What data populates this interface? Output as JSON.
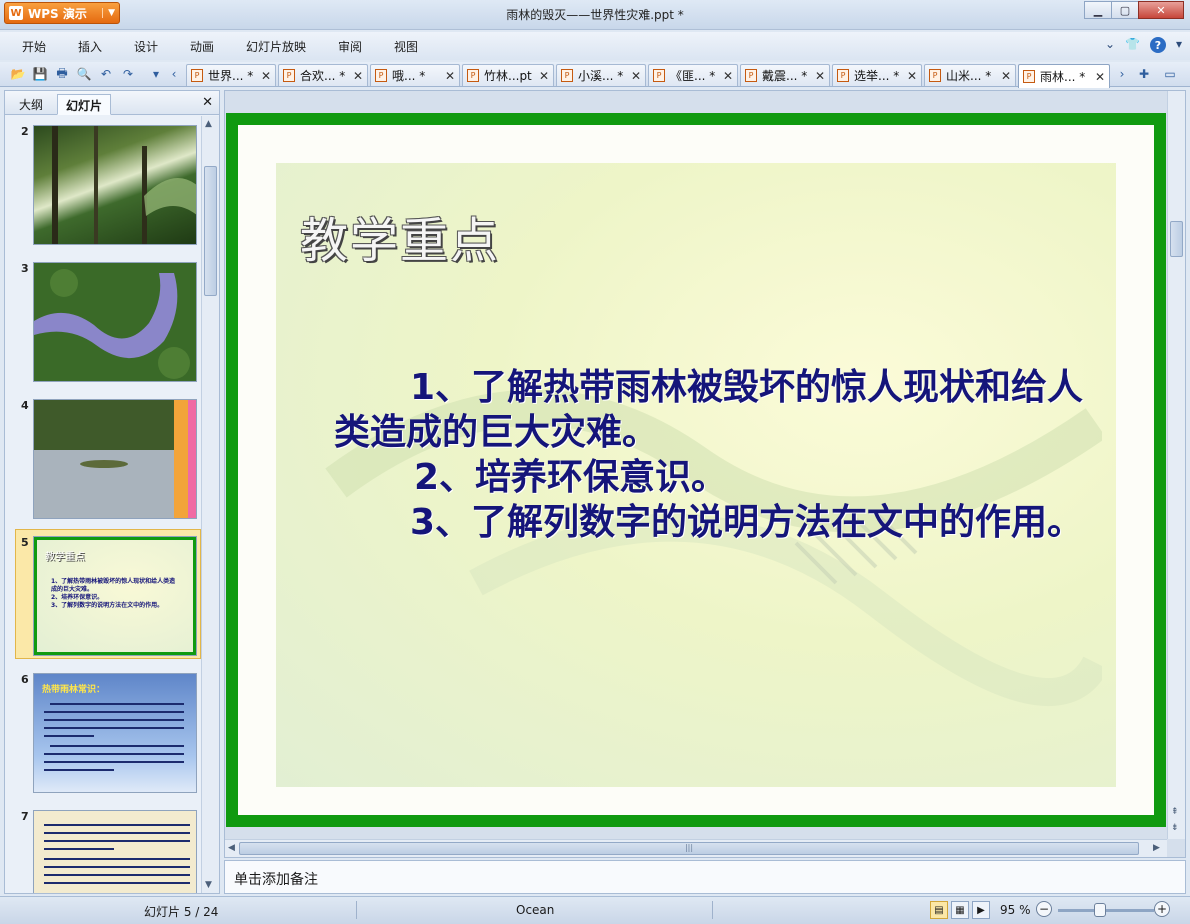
{
  "app": {
    "name": "WPS 演示",
    "window_title": "雨林的毁灭——世界性灾难.ppt *"
  },
  "menu": [
    "开始",
    "插入",
    "设计",
    "动画",
    "幻灯片放映",
    "审阅",
    "视图"
  ],
  "tabs": [
    {
      "label": "世界... *"
    },
    {
      "label": "合欢... *"
    },
    {
      "label": "哦... *"
    },
    {
      "label": "竹林...pt"
    },
    {
      "label": "小溪... *"
    },
    {
      "label": "《匪... *"
    },
    {
      "label": "戴震... *"
    },
    {
      "label": "选举... *"
    },
    {
      "label": "山米... *"
    },
    {
      "label": "雨林... *"
    }
  ],
  "left_pane": {
    "tabs": [
      "大纲",
      "幻灯片"
    ],
    "active_tab": "幻灯片",
    "thumbnails": [
      {
        "number": "2"
      },
      {
        "number": "3"
      },
      {
        "number": "4"
      },
      {
        "number": "5",
        "title": "教学重点",
        "selected": true
      },
      {
        "number": "6",
        "title": "热带雨林常识："
      },
      {
        "number": "7"
      }
    ]
  },
  "slide": {
    "title": "教学重点",
    "body": [
      "1、了解热带雨林被毁坏的惊人现状和给人类造成的巨大灾难。",
      "2、培养环保意识。",
      "3、了解列数字的说明方法在文中的作用。"
    ]
  },
  "notes_placeholder": "单击添加备注",
  "status": {
    "slide_counter": "幻灯片 5 / 24",
    "theme": "Ocean",
    "zoom": "95 %"
  },
  "colors": {
    "slide_border": "#109a10",
    "slide_text": "#15157a",
    "app_button": "#e56a10"
  }
}
